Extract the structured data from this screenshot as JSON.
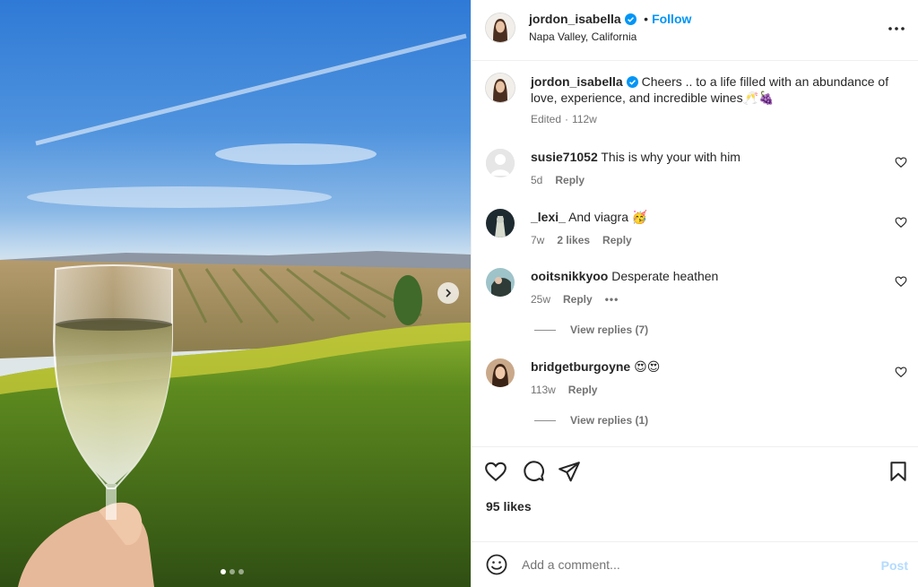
{
  "post": {
    "author": "jordon_isabella",
    "follow_separator": "•",
    "follow_label": "Follow",
    "location": "Napa Valley, California",
    "caption": {
      "username": "jordon_isabella",
      "text": "Cheers .. to a life filled with an abundance of love, experience, and incredible wines",
      "emoji": "🥂🍇",
      "edited": "Edited",
      "sep": "·",
      "age": "112w"
    }
  },
  "comments": [
    {
      "username": "susie71052",
      "text": "This is why your with him",
      "age": "5d",
      "reply_label": "Reply"
    },
    {
      "username": "_lexi_",
      "text": "And viagra 🥳",
      "age": "7w",
      "likes": "2 likes",
      "reply_label": "Reply"
    },
    {
      "username": "ooitsnikkyoo",
      "text": "Desperate heathen",
      "age": "25w",
      "reply_label": "Reply",
      "more": "•••",
      "view_replies": "View replies (7)"
    },
    {
      "username": "bridgetburgoyne",
      "text": "😍😍",
      "age": "113w",
      "reply_label": "Reply",
      "view_replies": "View replies (1)"
    }
  ],
  "likes": "95 likes",
  "add_comment": {
    "placeholder": "Add a comment...",
    "post_label": "Post"
  },
  "carousel": {
    "slides": 3,
    "active": 0
  },
  "icons": [
    "verified-icon",
    "more-icon",
    "heart-icon",
    "comment-icon",
    "share-icon",
    "bookmark-icon",
    "emoji-icon",
    "chevron-right-icon"
  ],
  "colors": {
    "accent": "#0095f6",
    "post_disabled": "#b3dbff",
    "verified": "#0095f6",
    "text": "#262626",
    "secondary": "#737373"
  }
}
